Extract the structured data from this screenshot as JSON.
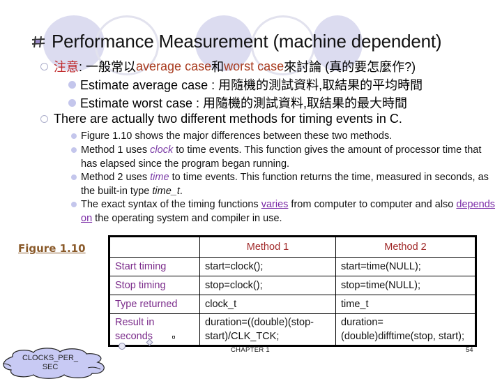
{
  "slide": {
    "title": "Performance Measurement (machine dependent)",
    "bullets_level1": [
      {
        "note_label": "注意",
        "sep": ": 一般常以 ",
        "term1": "average case",
        "mid": " 和 ",
        "term2": "worst case",
        "tail": " 來討論 (真的要怎麼作?)"
      },
      {
        "text": "There are actually two different methods for timing events in C."
      }
    ],
    "bullets_level2": [
      "Estimate average case : 用隨機的測試資料,取結果的平均時間",
      "Estimate worst case : 用隨機的測試資料,取結果的最大時間"
    ],
    "bullets_level3": {
      "b1": "Figure 1.10 shows the major differences between these two methods.",
      "b2_pre": "Method 1 uses ",
      "b2_em": "clock",
      "b2_post": " to time events. This function gives the amount of processor time that has elapsed since the program began running.",
      "b3_pre": "Method 2 uses ",
      "b3_em": "time",
      "b3_mid": " to time events. This function returns the time, measured in seconds, as the built-in type ",
      "b3_em2": "time_t",
      "b3_post": ".",
      "b4_pre": "The exact syntax of the timing functions ",
      "b4_link1": "varies",
      "b4_mid": " from computer to computer and also ",
      "b4_link2": "depends on",
      "b4_post": " the operating system and compiler in use."
    },
    "figure_label": "Figure 1.10",
    "table": {
      "headers": [
        "",
        "Method 1",
        "Method 2"
      ],
      "rows": [
        [
          "Start timing",
          "start=clock();",
          "start=time(NULL);"
        ],
        [
          "Stop timing",
          "stop=clock();",
          "stop=time(NULL);"
        ],
        [
          "Type returned",
          "clock_t",
          "time_t"
        ],
        [
          "Result in seconds",
          "duration=((double)(stop-start)/CLK_TCK;",
          "duration=(double)difftime(stop, start);"
        ]
      ]
    },
    "callout": "CLOCKS_PER_ SEC",
    "footer": {
      "chapter": "CHAPTER 1",
      "page": "54"
    }
  }
}
